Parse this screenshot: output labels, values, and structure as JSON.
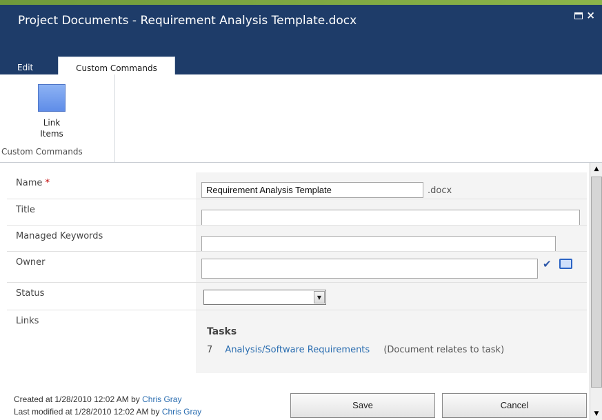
{
  "window": {
    "title": "Project Documents - Requirement Analysis Template.docx",
    "maximize_icon": "maximize-icon",
    "close_label": "×"
  },
  "ribbon": {
    "tabs": [
      {
        "label": "Edit",
        "active": false
      },
      {
        "label": "Custom Commands",
        "active": true
      }
    ],
    "link_items_label_1": "Link",
    "link_items_label_2": "Items",
    "group_label": "Custom Commands"
  },
  "form": {
    "name": {
      "label": "Name",
      "required_marker": "*",
      "value": "Requirement Analysis Template",
      "suffix": ".docx"
    },
    "title": {
      "label": "Title",
      "value": ""
    },
    "managed_keywords": {
      "label": "Managed Keywords",
      "value": ""
    },
    "owner": {
      "label": "Owner",
      "value": ""
    },
    "status": {
      "label": "Status",
      "value": ""
    },
    "links": {
      "label": "Links",
      "tasks_heading": "Tasks",
      "task": {
        "id": "7",
        "link": "Analysis/Software Requirements",
        "description": "(Document relates to task)"
      }
    }
  },
  "footer": {
    "created_prefix": "Created at 1/28/2010 12:02 AM by",
    "created_by": "Chris Gray",
    "modified_prefix": "Last modified at 1/28/2010 12:02 AM by",
    "modified_by": "Chris Gray",
    "save_label": "Save",
    "cancel_label": "Cancel"
  },
  "colors": {
    "title_bar": "#1e3c69",
    "link": "#2a6db0",
    "required": "#c00000"
  }
}
